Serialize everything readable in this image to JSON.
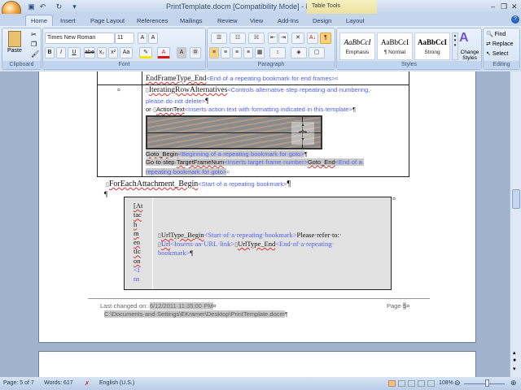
{
  "window": {
    "title": "PrintTemplate.docm [Compatibility Mode] - Microsoft Word",
    "contextual_tab": "Table Tools"
  },
  "tabs": [
    "Home",
    "Insert",
    "Page Layout",
    "References",
    "Mailings",
    "Review",
    "View",
    "Add-Ins",
    "Design",
    "Layout"
  ],
  "ribbon": {
    "clipboard": {
      "label": "Clipboard",
      "paste": "Paste"
    },
    "font": {
      "label": "Font",
      "name": "Times New Roman",
      "size": "11",
      "bold": "B",
      "italic": "I",
      "underline": "U",
      "strike": "abe",
      "subscript": "x₂",
      "superscript": "x²",
      "change_case": "Aa",
      "grow": "A",
      "shrink": "A",
      "font_color": "A",
      "char_shade": "A"
    },
    "paragraph": {
      "label": "Paragraph",
      "pilcrow": "¶",
      "sort": "A↓"
    },
    "styles": {
      "label": "Styles",
      "items": [
        {
          "preview": "AaBbCcI",
          "name": "Emphasis"
        },
        {
          "preview": "AaBbCcI",
          "name": "¶ Normal"
        },
        {
          "preview": "AaBbCcI",
          "name": "Strong"
        }
      ],
      "change_styles": "Change Styles"
    },
    "editing": {
      "label": "Editing",
      "find": "Find",
      "replace": "Replace",
      "select": "Select"
    }
  },
  "document": {
    "row1": {
      "field": "EndFrameType_End",
      "hint": "<End·of·a·repeating·bookmark·for·end·frames>"
    },
    "row2": {
      "field1": "IteratingRowAlternatives",
      "hint1": "<Controls·alternative·step·repeating·and·numbering,·",
      "hint1b": "please·do·not·delete>",
      "prefix2": "or·",
      "field2": "ActionText",
      "hint2": "<Inserts·action·text·with·formatting·indicated·in·this·template>",
      "field3": "Goto_Begin",
      "hint3": "<Beginning·of·a·repeating·bookmark·for·goto>",
      "prefix4": "Go·to·step·",
      "field4": "TargetFrameNum",
      "hint4": "<Inserts·target·frame·number>",
      "field5": "Goto_End",
      "hint5": "<End·of·a·",
      "hint5b": "repeating·bookmark·for·goto>"
    },
    "foreach": {
      "field": "ForEachAttachment_Begin",
      "hint": "<Start·of·a·repeating·bookmark>"
    },
    "inner": {
      "left_lines": [
        "[At",
        "tac",
        "h",
        "m",
        "en",
        "tIc",
        "on",
        "<I",
        "ns"
      ],
      "field1": "UrlType_Begin",
      "hint1": "<Start·of·a·repeating·bookmark>",
      "text1": "Please·refer·to:·",
      "field2": "Url",
      "hint2": "<Inserts·an·URL·link>",
      "field3": "UrlType_End",
      "hint3": "<End·of·a·repeating·",
      "hint3b": "bookmark>"
    },
    "footer": {
      "label": "Last·changed·on:·",
      "date": "6/12/2011·11:35:00·PM",
      "page_label": "Page·",
      "page_num": "5",
      "path": "C:\\Documents·and·Settings\\EKramer\\Desktop\\PrintTemplate.docm"
    }
  },
  "status": {
    "page": "Page: 5 of 7",
    "words": "Words: 617",
    "language": "English (U.S.)",
    "zoom": "108%"
  }
}
